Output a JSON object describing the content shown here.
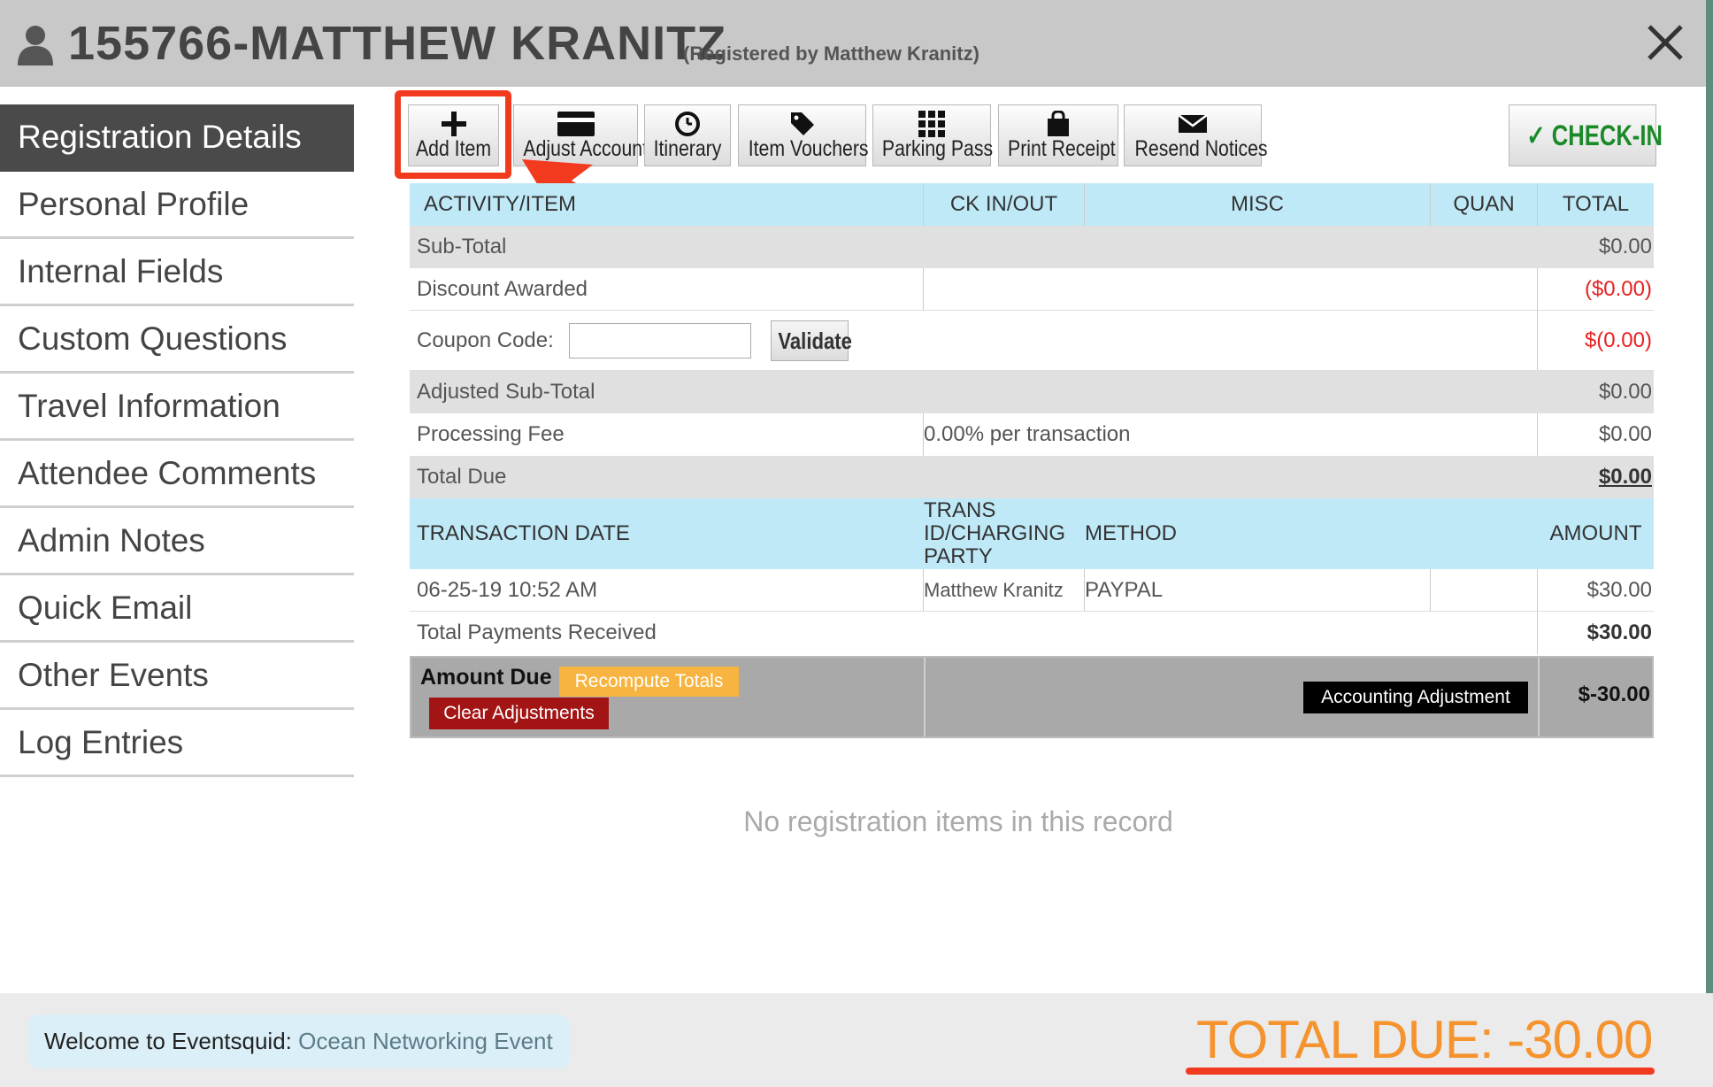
{
  "header": {
    "title": "155766-MATTHEW KRANITZ",
    "subtitle": "(Registered by Matthew Kranitz)"
  },
  "sidebar": {
    "items": [
      {
        "label": "Registration Details",
        "active": true
      },
      {
        "label": "Personal Profile"
      },
      {
        "label": "Internal Fields"
      },
      {
        "label": "Custom Questions"
      },
      {
        "label": "Travel Information"
      },
      {
        "label": "Attendee Comments"
      },
      {
        "label": "Admin Notes"
      },
      {
        "label": "Quick Email"
      },
      {
        "label": "Other Events"
      },
      {
        "label": "Log Entries"
      }
    ]
  },
  "toolbar": {
    "add_item": "Add Item",
    "adjust_account": "Adjust Account",
    "itinerary": "Itinerary",
    "item_vouchers": "Item Vouchers",
    "parking_pass": "Parking Pass",
    "print_receipt": "Print Receipt",
    "resend_notices": "Resend Notices",
    "checkin": "✓ CHECK-IN"
  },
  "items_table": {
    "headers": [
      "ACTIVITY/ITEM",
      "CK IN/OUT",
      "MISC",
      "QUAN",
      "TOTAL"
    ],
    "subtotal_label": "Sub-Total",
    "subtotal_value": "$0.00",
    "discount_label": "Discount Awarded",
    "discount_value": "($0.00)",
    "coupon_label": "Coupon Code:",
    "coupon_value": "",
    "validate_label": "Validate",
    "coupon_amount": "$(0.00)",
    "adjusted_label": "Adjusted Sub-Total",
    "adjusted_value": "$0.00",
    "fee_label": "Processing Fee",
    "fee_rate": "0.00%  per transaction",
    "fee_value": "$0.00",
    "total_due_label": "Total Due",
    "total_due_value": "$0.00"
  },
  "payments_table": {
    "headers": [
      "TRANSACTION DATE",
      "TRANS ID/CHARGING PARTY",
      "METHOD",
      "",
      "AMOUNT"
    ],
    "rows": [
      {
        "date": "06-25-19 10:52 AM",
        "party": "Matthew Kranitz",
        "method": "PAYPAL",
        "extra": "",
        "amount": "$30.00"
      }
    ],
    "total_label": "Total Payments Received",
    "total_value": "$30.00"
  },
  "amount_due": {
    "label": "Amount Due",
    "recompute": "Recompute Totals",
    "clear": "Clear Adjustments",
    "accounting": "Accounting Adjustment",
    "value": "$-30.00"
  },
  "empty_message": "No registration items in this record",
  "footer": {
    "welcome_prefix": "Welcome to Eventsquid:",
    "event_name": "Ocean Networking Event",
    "total_due": "TOTAL DUE: -30.00"
  },
  "colors": {
    "highlight": "#f23a1f",
    "header_blue": "#bfe9f7",
    "checkin_green": "#1a8a28",
    "total_orange": "#f5932e"
  }
}
